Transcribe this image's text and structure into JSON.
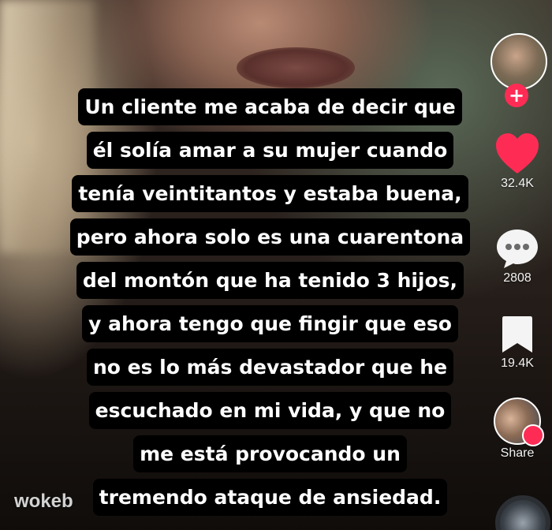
{
  "caption": {
    "lines": [
      "Un cliente me acaba de decir que",
      "él solía amar a su mujer cuando",
      "tenía veintitantos y estaba buena,",
      "pero ahora solo es una cuarentona",
      "del montón que ha tenido 3 hijos,",
      "y ahora tengo que fingir que eso",
      "no es lo más devastador que he",
      "escuchado en mi vida, y que no",
      "me está provocando un",
      "tremendo ataque de ansiedad."
    ]
  },
  "sidebar": {
    "likes_count": "32.4K",
    "comments_count": "2808",
    "saves_count": "19.4K",
    "share_label": "Share"
  },
  "watermark": "wokeb",
  "colors": {
    "caption_background": "#000000",
    "caption_text": "#ffffff",
    "like_red": "#fe2c55"
  },
  "icons": [
    "plus-icon",
    "heart-icon",
    "comment-icon",
    "bookmark-icon",
    "share-icon",
    "music-disc-icon"
  ]
}
